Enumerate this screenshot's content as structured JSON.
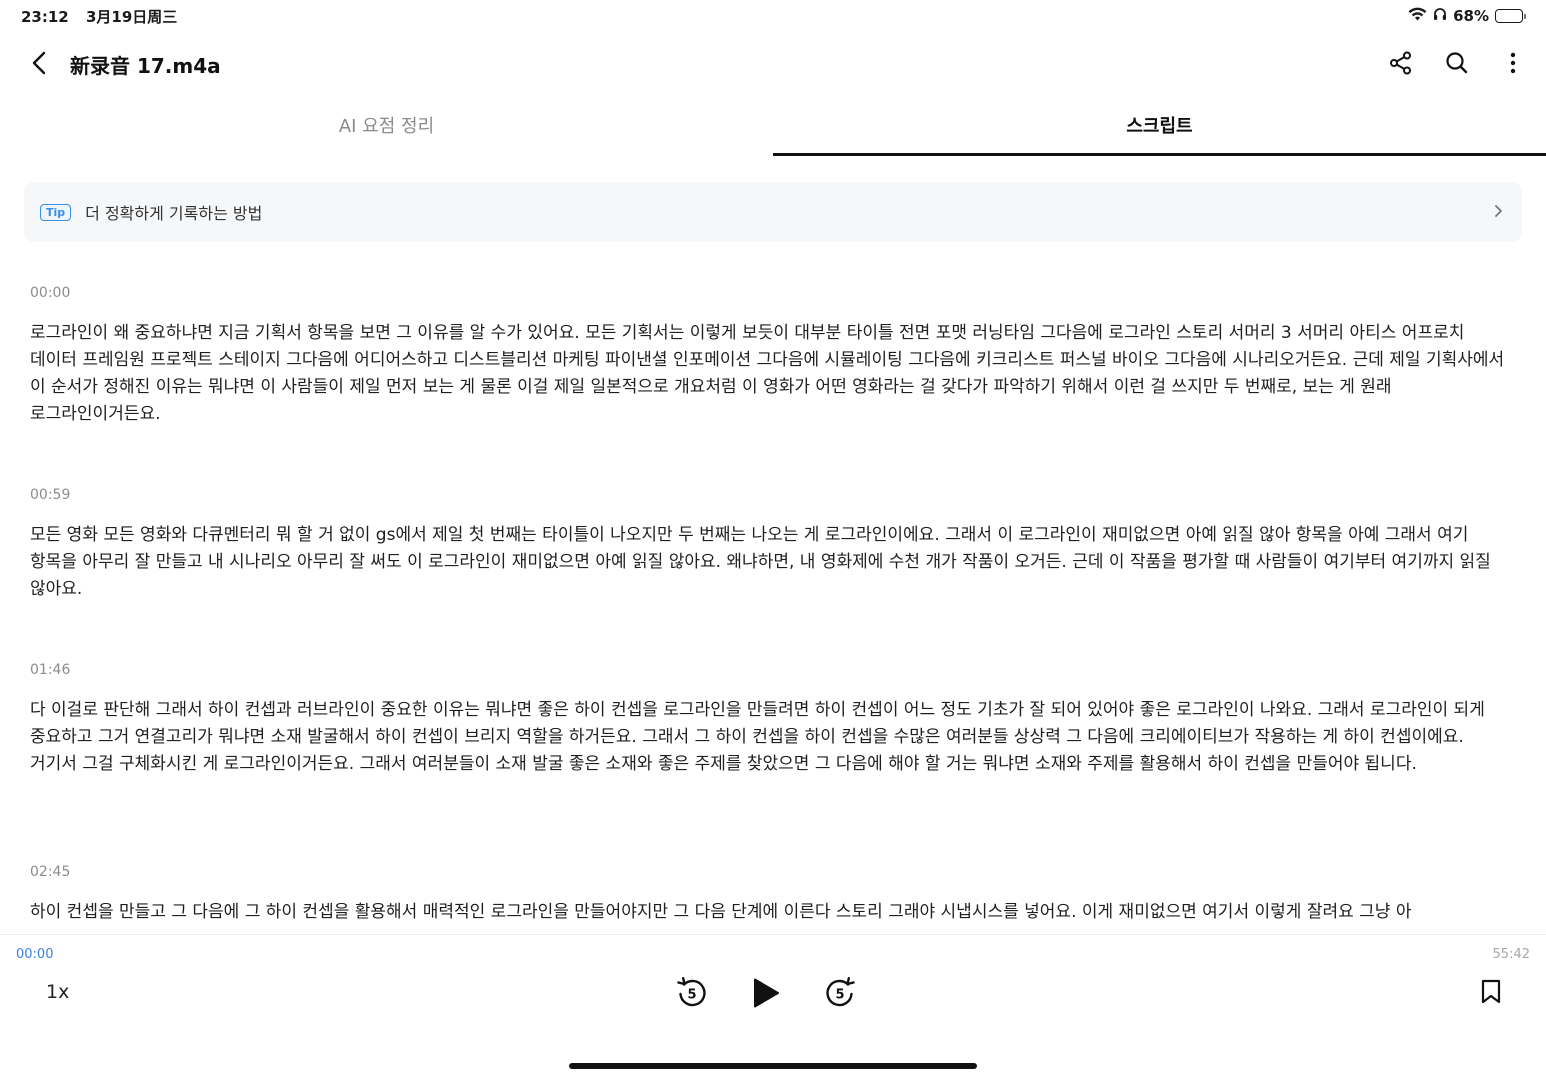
{
  "status_bar": {
    "time": "23:12",
    "date": "3月19日周三",
    "battery": "68%",
    "battery_level": 0.68
  },
  "nav": {
    "title": "新录音 17.m4a",
    "icons": [
      "back-icon",
      "share-icon",
      "search-icon",
      "more-icon"
    ]
  },
  "tabs": [
    {
      "label": "AI 요점 정리",
      "active": false
    },
    {
      "label": "스크립트",
      "active": true
    }
  ],
  "tip": {
    "badge": "Tip",
    "text": "더 정확하게 기록하는 방법"
  },
  "segments": [
    {
      "time": "00:00",
      "text": "로그라인이 왜 중요하냐면 지금 기획서 항목을 보면  그 이유를 알 수가 있어요. 모든  기획서는 이렇게 보듯이 대부분  타이틀 전면 포맷 러닝타임 그다음에 로그라인 스토리 서머리 3 서머리 아티스 어프로치  데이터 프레임원 프로젝트 스테이지  그다음에 어디어스하고 디스트블리션 마케팅 파이낸셜 인포메이션 그다음에 시뮬레이팅  그다음에 키크리스트 퍼스널 바이오 그다음에 시나리오거든요.  근데 제일 기획사에서 이 순서가 정해진  이유는 뭐냐면 이 사람들이 제일 먼저 보는 게 물론 이걸 제일 일본적으로 개요처럼 이 영화가 어떤 영화라는  걸 갖다가 파악하기 위해서 이런 걸 쓰지만 두 번째로,  보는 게 원래 로그라인이거든요."
    },
    {
      "time": "00:59",
      "text": " 모든 영화 모든 영화와 다큐멘터리 뭐 할 거 없이 gs에서 제일 첫 번째는 타이틀이 나오지만  두 번째는 나오는 게 로그라인이에요. 그래서 이 로그라인이 재미없으면 아예 읽질  않아 항목을 아예 그래서 여기 항목을 아무리 잘  만들고 내 시나리오 아무리 잘 써도 이 로그라인이 재미없으면 아예 읽질  않아요. 왜냐하면, 내 영화제에 수천 개가 작품이 오거든. 근데 이 작품을 평가할  때 사람들이 여기부터 여기까지  읽질 않아요."
    },
    {
      "time": "01:46",
      "text": " 다 이걸로 판단해 그래서 하이 컨셉과  러브라인이 중요한 이유는 뭐냐면 좋은 하이 컨셉을  로그라인을 만들려면  하이 컨셉이 어느 정도 기초가 잘 되어 있어야 좋은 로그라인이 나와요. 그래서 로그라인이 되게 중요하고  그거 연결고리가 뭐냐면 소재  발굴해서 하이 컨셉이 브리지 역할을 하거든요. 그래서 그 하이 컨셉을 하이 컨셉을  수많은 여러분들 상상력 그 다음에 크리에이티브가  작용하는 게 하이 컨셉이에요. 거기서 그걸 구체화시킨 게 로그라인이거든요. 그래서 여러분들이  소재 발굴 좋은 소재와 좋은 주제를 찾았으면  그 다음에 해야 할 거는 뭐냐면 소재와 주제를 활용해서 하이 컨셉을 만들어야 됩니다."
    },
    {
      "time": "02:45",
      "text": " 하이 컨셉을 만들고 그 다음에 그 하이 컨셉을 활용해서 매력적인 로그라인을 만들어야지만  그 다음 단계에 이른다  스토리 그래야 시냅시스를 넣어요. 이게 재미없으면 여기서 이렇게 잘려요 그냥 아"
    }
  ],
  "player": {
    "current_time": "00:00",
    "duration": "55:42",
    "speed": "1x",
    "skip_seconds": "5"
  }
}
